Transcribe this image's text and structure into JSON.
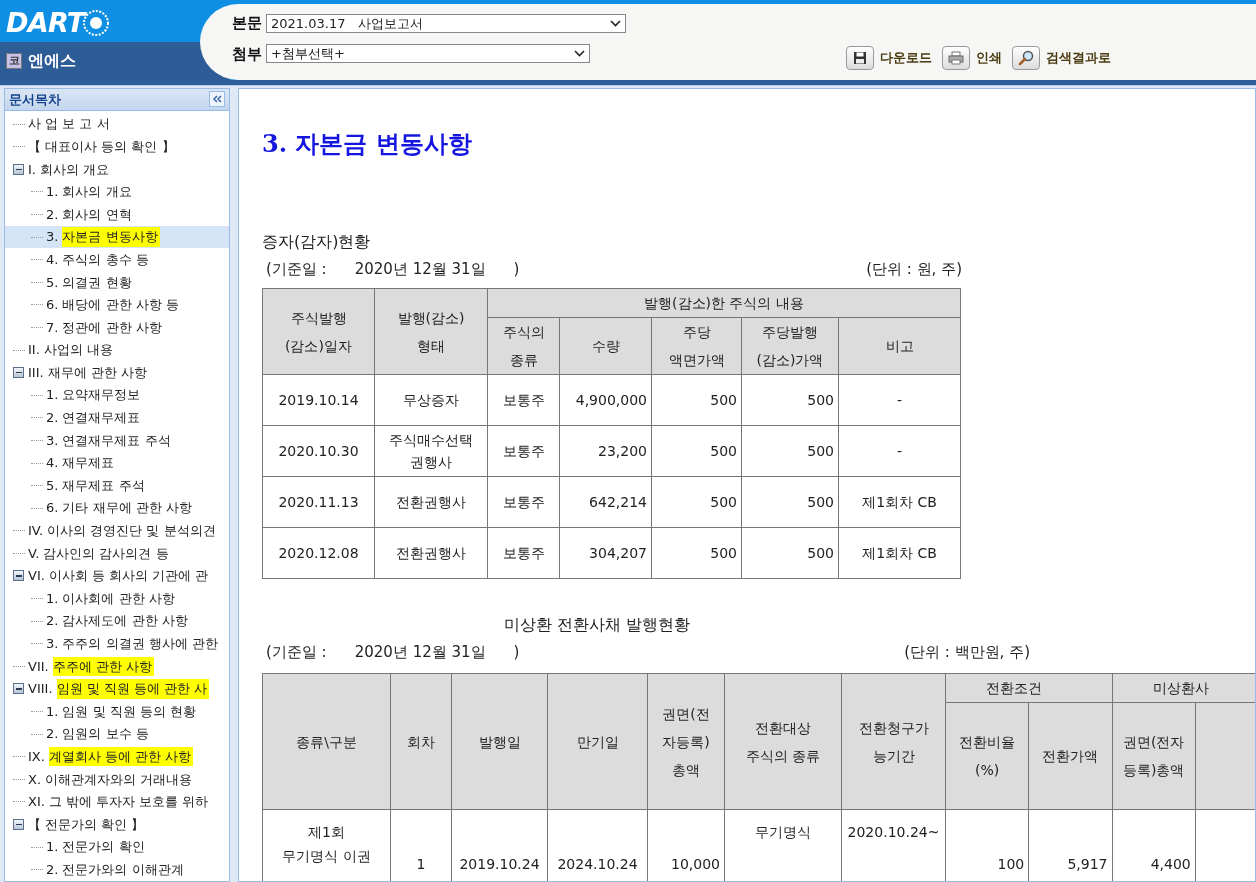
{
  "header": {
    "logo": "DART",
    "company_badge": "코",
    "company": "엔에스",
    "fields": [
      {
        "label": "본문",
        "value": "2021.03.17   사업보고서"
      },
      {
        "label": "첨부",
        "value": "+첨부선택+"
      }
    ],
    "actions": [
      {
        "kind": "download",
        "label": "다운로드"
      },
      {
        "kind": "print",
        "label": "인쇄"
      },
      {
        "kind": "search",
        "label": "검색결과로"
      }
    ]
  },
  "sidebar": {
    "title": "문서목차",
    "items": [
      {
        "label": "사 업 보 고 서",
        "highlighted": false,
        "selected": false
      },
      {
        "label": "【 대표이사 등의 확인 】",
        "highlighted": false,
        "selected": false
      },
      {
        "number": "I.",
        "label": "회사의 개요",
        "highlighted": false,
        "selected": false,
        "expanded": true,
        "children": [
          {
            "number": "1.",
            "label": "회사의 개요",
            "highlighted": false,
            "selected": false
          },
          {
            "number": "2.",
            "label": "회사의 연혁",
            "highlighted": false,
            "selected": false
          },
          {
            "number": "3.",
            "label": "자본금 변동사항",
            "highlighted": true,
            "selected": true
          },
          {
            "number": "4.",
            "label": "주식의 총수 등",
            "highlighted": false,
            "selected": false
          },
          {
            "number": "5.",
            "label": "의결권 현황",
            "highlighted": false,
            "selected": false
          },
          {
            "number": "6.",
            "label": "배당에 관한 사항 등",
            "highlighted": false,
            "selected": false
          },
          {
            "number": "7.",
            "label": "정관에 관한 사항",
            "highlighted": false,
            "selected": false
          }
        ]
      },
      {
        "number": "II.",
        "label": "사업의 내용",
        "highlighted": false,
        "selected": false
      },
      {
        "number": "III.",
        "label": "재무에 관한 사항",
        "highlighted": false,
        "selected": false,
        "expanded": true,
        "children": [
          {
            "number": "1.",
            "label": "요약재무정보",
            "highlighted": false,
            "selected": false
          },
          {
            "number": "2.",
            "label": "연결재무제표",
            "highlighted": false,
            "selected": false
          },
          {
            "number": "3.",
            "label": "연결재무제표 주석",
            "highlighted": false,
            "selected": false
          },
          {
            "number": "4.",
            "label": "재무제표",
            "highlighted": false,
            "selected": false
          },
          {
            "number": "5.",
            "label": "재무제표 주석",
            "highlighted": false,
            "selected": false
          },
          {
            "number": "6.",
            "label": "기타 재무에 관한 사항",
            "highlighted": false,
            "selected": false
          }
        ]
      },
      {
        "number": "IV.",
        "label": "이사의 경영진단 및 분석의견",
        "highlighted": false,
        "selected": false
      },
      {
        "number": "V.",
        "label": "감사인의 감사의견 등",
        "highlighted": false,
        "selected": false
      },
      {
        "number": "VI.",
        "label": "이사회 등 회사의 기관에 관",
        "highlighted": false,
        "selected": false,
        "expanded": true,
        "children": [
          {
            "number": "1.",
            "label": "이사회에 관한 사항",
            "highlighted": false,
            "selected": false
          },
          {
            "number": "2.",
            "label": "감사제도에 관한 사항",
            "highlighted": false,
            "selected": false
          },
          {
            "number": "3.",
            "label": "주주의 의결권 행사에 관한",
            "highlighted": false,
            "selected": false
          }
        ]
      },
      {
        "number": "VII.",
        "label": "주주에 관한 사항",
        "highlighted": true,
        "selected": false
      },
      {
        "number": "VIII.",
        "label": "임원 및 직원 등에 관한 사",
        "highlighted": true,
        "selected": false,
        "expanded": true,
        "children": [
          {
            "number": "1.",
            "label": "임원 및 직원 등의 현황",
            "highlighted": false,
            "selected": false
          },
          {
            "number": "2.",
            "label": "임원의 보수 등",
            "highlighted": false,
            "selected": false
          }
        ]
      },
      {
        "number": "IX.",
        "label": "계열회사 등에 관한 사항",
        "highlighted": true,
        "selected": false
      },
      {
        "number": "X.",
        "label": "이해관계자와의 거래내용",
        "highlighted": false,
        "selected": false
      },
      {
        "number": "XI.",
        "label": "그 밖에 투자자 보호를 위하",
        "highlighted": false,
        "selected": false
      },
      {
        "label": "【 전문가의 확인 】",
        "highlighted": false,
        "selected": false,
        "expanded": true,
        "children": [
          {
            "number": "1.",
            "label": "전문가의 확인",
            "highlighted": false,
            "selected": false
          },
          {
            "number": "2.",
            "label": "전문가와의 이해관계",
            "highlighted": false,
            "selected": false
          }
        ]
      }
    ]
  },
  "document": {
    "title": "3. 자본금 변동사항",
    "section1": {
      "title": "증자(감자)현황",
      "base_date_label": "(기준일 :",
      "base_date": "2020년 12월 31일",
      "base_date_close": ")",
      "unit": "(단위 : 원, 주)",
      "table": {
        "lead_columns": [
          "주식발행\n(감소)일자",
          "발행(감소)\n형태"
        ],
        "group": "발행(감소)한 주식의 내용",
        "sub_columns": [
          "주식의\n종류",
          "수량",
          "주당\n액면가액",
          "주당발행\n(감소)가액",
          "비고"
        ],
        "rows": [
          [
            "2019.10.14",
            "무상증자",
            "보통주",
            "4,900,000",
            "500",
            "500",
            "-"
          ],
          [
            "2020.10.30",
            "주식매수선택\n권행사",
            "보통주",
            "23,200",
            "500",
            "500",
            "-"
          ],
          [
            "2020.11.13",
            "전환권행사",
            "보통주",
            "642,214",
            "500",
            "500",
            "제1회차   CB"
          ],
          [
            "2020.12.08",
            "전환권행사",
            "보통주",
            "304,207",
            "500",
            "500",
            "제1회차   CB"
          ]
        ]
      }
    },
    "section2": {
      "title": "미상환 전환사채 발행현황",
      "base_date_label": "(기준일 :",
      "base_date": "2020년 12월 31일",
      "base_date_close": ")",
      "unit": "(단위 : 백만원, 주)",
      "table": {
        "lead_columns": [
          "종류\\구분",
          "회차",
          "발행일",
          "만기일",
          "권면(전\n자등록)\n총액",
          "전환대상\n주식의 종류",
          "전환청구가\n능기간"
        ],
        "groups": [
          {
            "label": "전환조건",
            "sub_columns": [
              "전환비율\n(%)",
              "전환가액"
            ]
          },
          {
            "label": "미상환사",
            "sub_columns": [
              "권면(전자\n등록)총액"
            ]
          }
        ],
        "row": [
          "제1회\n무기명식 이권",
          "1",
          "2019.10.24",
          "2024.10.24",
          "10,000",
          "무기명식",
          "2020.10.24~",
          "100",
          "5,917",
          "4,400"
        ]
      }
    }
  }
}
